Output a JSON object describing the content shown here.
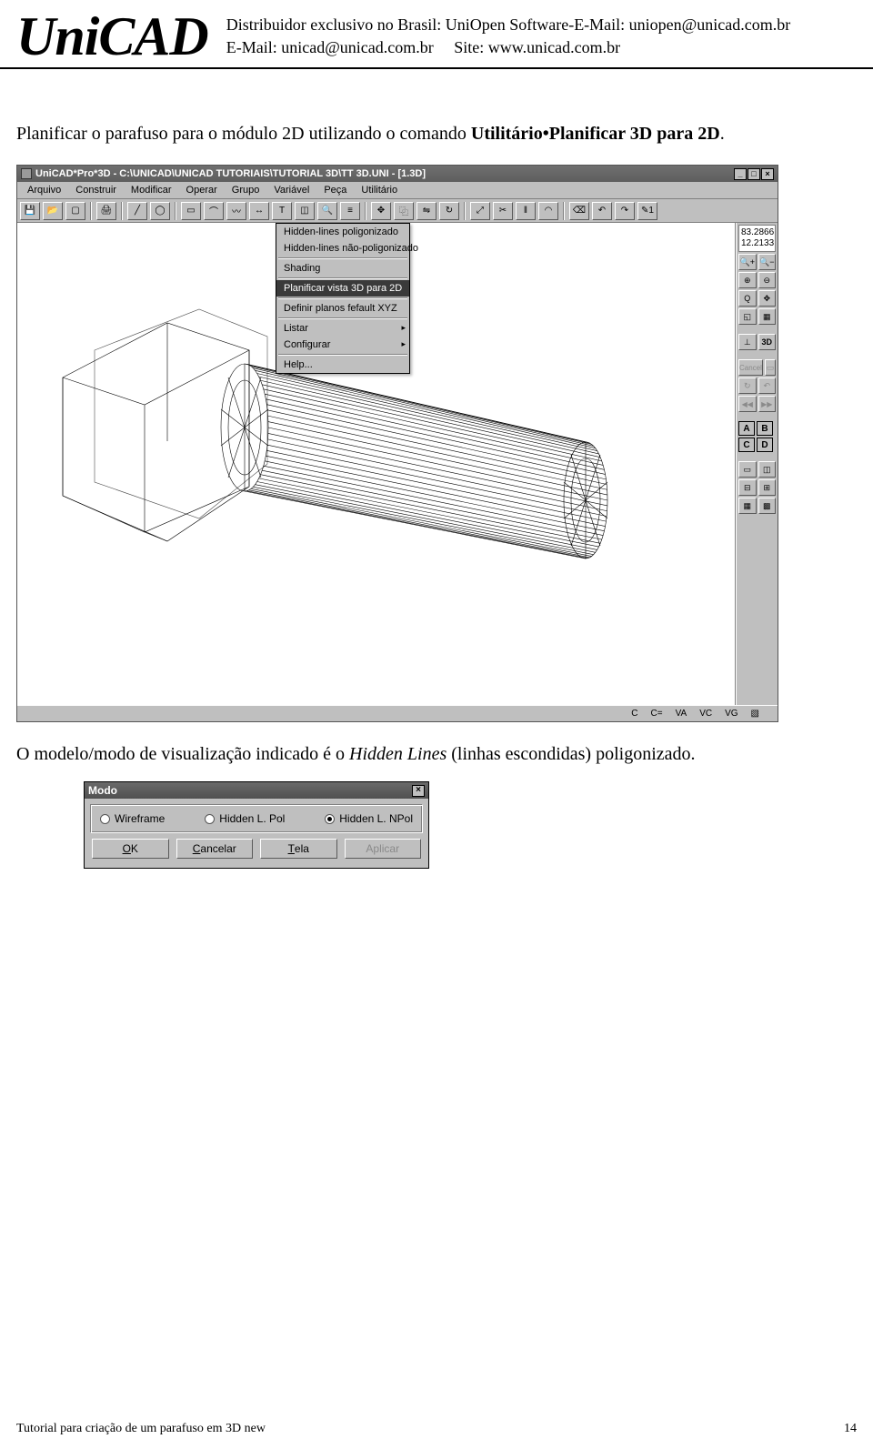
{
  "header": {
    "logo": "UniCAD",
    "line1": "Distribuidor exclusivo no Brasil: UniOpen Software-E-Mail: uniopen@unicad.com.br",
    "line2_a": "E-Mail: unicad@unicad.com.br",
    "line2_b": "Site: www.unicad.com.br"
  },
  "para1": {
    "t1": "Planificar o parafuso para o módulo 2D utilizando o comando ",
    "bold": "Utilitário•Planificar 3D para 2D",
    "t2": "."
  },
  "app": {
    "title": "UniCAD*Pro*3D - C:\\UNICAD\\UNICAD TUTORIAIS\\TUTORIAL 3D\\TT 3D.UNI - [1.3D]",
    "menus": [
      "Arquivo",
      "Construir",
      "Modificar",
      "Operar",
      "Grupo",
      "Variável",
      "Peça",
      "Utilitário"
    ],
    "dropdown": [
      {
        "label": "Hidden-lines poligonizado",
        "hl": false
      },
      {
        "label": "Hidden-lines não-poligonizado",
        "hl": false
      },
      {
        "sep": true
      },
      {
        "label": "Shading",
        "hl": false
      },
      {
        "sep": true
      },
      {
        "label": "Planificar vista 3D para 2D",
        "hl": true
      },
      {
        "sep": true
      },
      {
        "label": "Definir planos fefault XYZ",
        "hl": false
      },
      {
        "sep": true
      },
      {
        "label": "Listar",
        "hl": false,
        "arrow": true
      },
      {
        "label": "Configurar",
        "hl": false,
        "arrow": true
      },
      {
        "sep": true
      },
      {
        "label": "Help...",
        "hl": false
      }
    ],
    "toolbar_icons": [
      "save",
      "open",
      "new",
      "print",
      "line",
      "circle",
      "select",
      "arc",
      "curve",
      "dim",
      "text",
      "view",
      "zoom",
      "layer",
      "move",
      "copy",
      "mirror",
      "rotate",
      "scale",
      "trim",
      "offset",
      "fillet",
      "erase",
      "undo",
      "redo",
      "pen1"
    ],
    "coords": {
      "x": "83.2866",
      "y": "12.2133"
    },
    "right_panel": {
      "zoom_icons": [
        "zoom-in-mag",
        "zoom-out-mag",
        "zoom-plus",
        "zoom-minus",
        "zoom-q",
        "pan",
        "zoom-all",
        "fit"
      ],
      "btn_axes": "axes",
      "btn_3d": "3D",
      "cancel": "Cancel",
      "views": [
        "A",
        "B",
        "C",
        "D"
      ],
      "layout_btns": [
        "l1",
        "l2",
        "l3",
        "l4",
        "l5",
        "l6"
      ]
    },
    "status": [
      "C",
      "C=",
      "VA",
      "VC",
      "VG"
    ]
  },
  "para2": {
    "t1": "O modelo/modo de visualização indicado é o ",
    "italic": "Hidden Lines",
    "t2": " (linhas escondidas) poligonizado."
  },
  "dialog": {
    "title": "Modo",
    "options": [
      {
        "label": "Wireframe",
        "sel": false
      },
      {
        "label": "Hidden L. Pol",
        "sel": false
      },
      {
        "label": "Hidden L. NPol",
        "sel": true
      }
    ],
    "buttons": [
      {
        "label": "OK",
        "u": "O",
        "rest": "K",
        "dis": false
      },
      {
        "label": "Cancelar",
        "u": "C",
        "rest": "ancelar",
        "dis": false
      },
      {
        "label": "Tela",
        "u": "T",
        "rest": "ela",
        "dis": false
      },
      {
        "label": "Aplicar",
        "u": "A",
        "rest": "plicar",
        "dis": true
      }
    ]
  },
  "footer": {
    "left": "Tutorial para criação de um parafuso em 3D new",
    "right": "14"
  }
}
